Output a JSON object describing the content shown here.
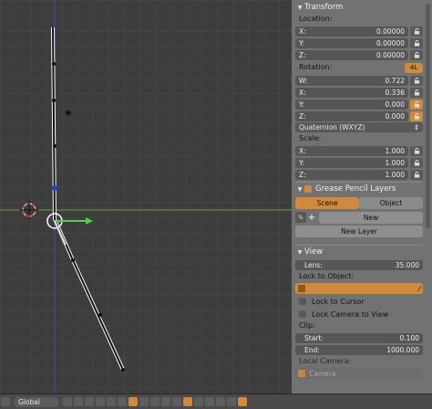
{
  "transform": {
    "title": "Transform",
    "location_label": "Location:",
    "location": [
      {
        "axis": "X:",
        "value": "0.00000",
        "locked": false
      },
      {
        "axis": "Y:",
        "value": "0.00000",
        "locked": false
      },
      {
        "axis": "Z:",
        "value": "0.00000",
        "locked": false
      }
    ],
    "rotation_label": "Rotation:",
    "rotation_4l": "4L",
    "rotation": [
      {
        "axis": "W:",
        "value": "0.722",
        "locked": false
      },
      {
        "axis": "X:",
        "value": "0.336",
        "locked": false
      },
      {
        "axis": "Y:",
        "value": "0.000",
        "locked": true
      },
      {
        "axis": "Z:",
        "value": "0.000",
        "locked": true
      }
    ],
    "rotation_mode": "Quaternion (WXYZ)",
    "scale_label": "Scale:",
    "scale": [
      {
        "axis": "X:",
        "value": "1.000",
        "locked": false
      },
      {
        "axis": "Y:",
        "value": "1.000",
        "locked": false
      },
      {
        "axis": "Z:",
        "value": "1.000",
        "locked": false
      }
    ]
  },
  "grease_pencil": {
    "title": "Grease Pencil Layers",
    "tab_scene": "Scene",
    "tab_object": "Object",
    "new_label": "New",
    "new_layer_label": "New Layer"
  },
  "view": {
    "title": "View",
    "lens_label": "Lens:",
    "lens_value": "35.000",
    "lock_object_label": "Lock to Object:",
    "lock_cursor_label": "Lock to Cursor",
    "lock_camera_label": "Lock Camera to View",
    "clip_label": "Clip:",
    "clip_start_label": "Start:",
    "clip_start_value": "0.100",
    "clip_end_label": "End:",
    "clip_end_value": "1000.000",
    "local_camera_label": "Local Camera:",
    "camera_value": "Camera"
  },
  "bottom_bar": {
    "orientation": "Global"
  },
  "colors": {
    "accent": "#d18a3a",
    "panel_bg": "#727272",
    "viewport_bg": "#3d3d3d",
    "x_axis": "#c0392b",
    "y_axis": "#6ab04c",
    "z_axis": "#3355ee"
  }
}
